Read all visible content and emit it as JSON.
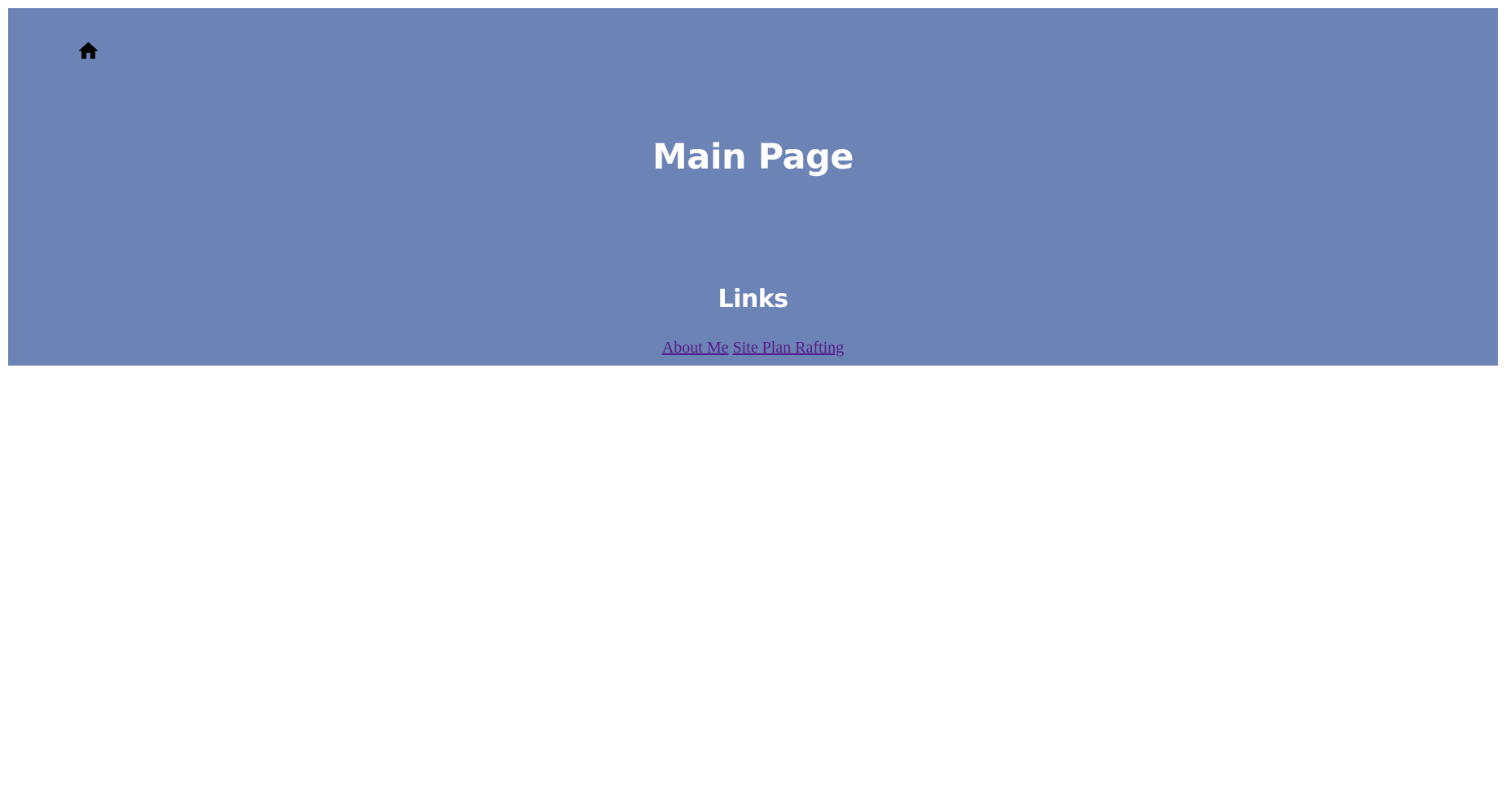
{
  "colors": {
    "hero_background": "#6c83b5",
    "heading_text": "#ffffff",
    "visited_link": "#551a8b",
    "home_icon": "#000000",
    "page_background": "#ffffff"
  },
  "header": {
    "home_icon": "home-icon"
  },
  "main": {
    "title": "Main Page"
  },
  "links": {
    "heading": "Links",
    "items": [
      {
        "label": "About Me"
      },
      {
        "label": "Site Plan Rafting"
      }
    ]
  }
}
